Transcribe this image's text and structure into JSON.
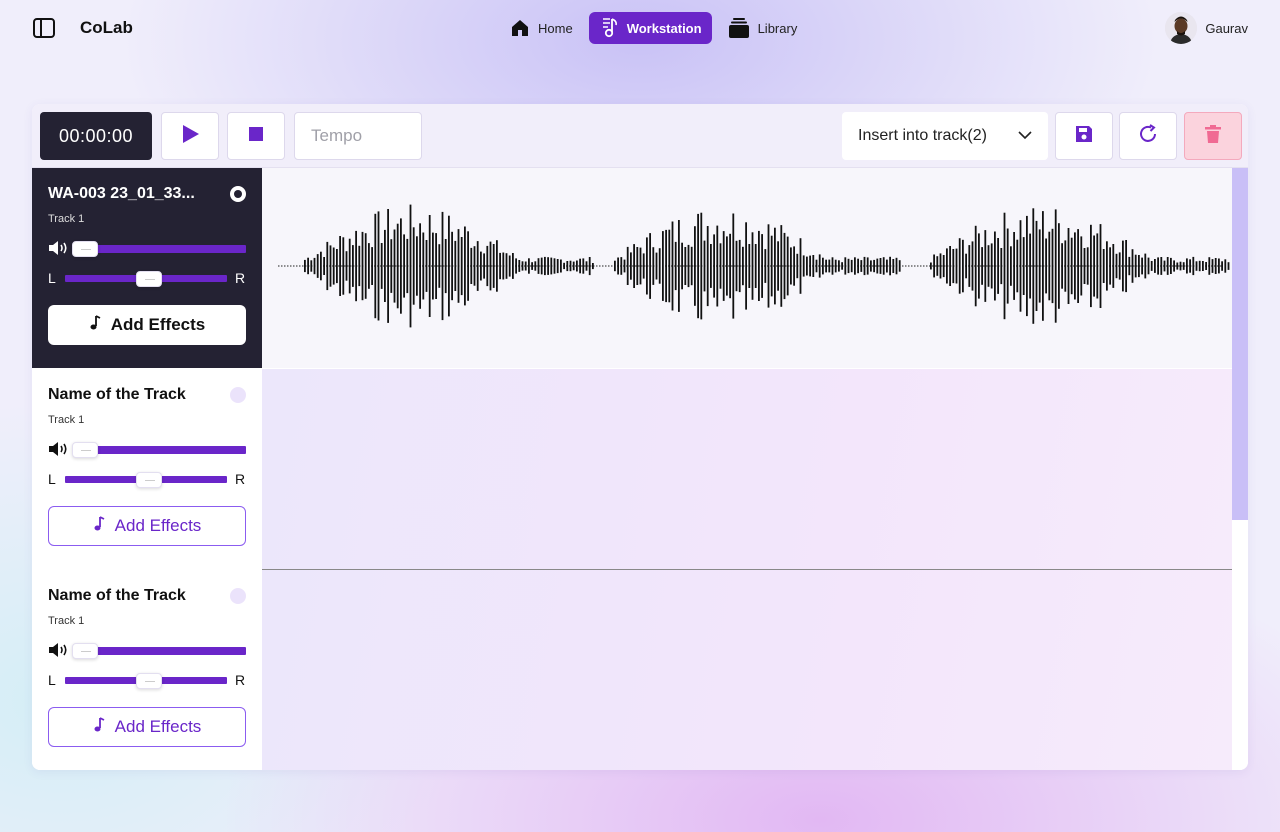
{
  "app": {
    "name": "CoLab"
  },
  "nav": {
    "items": [
      {
        "label": "Home",
        "icon": "home-icon",
        "active": false
      },
      {
        "label": "Workstation",
        "icon": "music-note-icon",
        "active": true
      },
      {
        "label": "Library",
        "icon": "library-icon",
        "active": false
      }
    ]
  },
  "user": {
    "name": "Gaurav"
  },
  "toolbar": {
    "time": "00:00:00",
    "tempo_placeholder": "Tempo",
    "insert_select": "Insert into track(2)"
  },
  "tracks": [
    {
      "name": "WA-003 23_01_33...",
      "subtitle": "Track 1",
      "effects_label": "Add Effects",
      "selected": true,
      "has_audio": true,
      "volume": 0.0,
      "pan": 0.5
    },
    {
      "name": "Name of the Track",
      "subtitle": "Track 1",
      "effects_label": "Add Effects",
      "selected": false,
      "has_audio": false,
      "volume": 0.0,
      "pan": 0.5
    },
    {
      "name": "Name of the Track",
      "subtitle": "Track 1",
      "effects_label": "Add Effects",
      "selected": false,
      "has_audio": false,
      "volume": 0.0,
      "pan": 0.5
    }
  ],
  "pan_labels": {
    "left": "L",
    "right": "R"
  },
  "colors": {
    "accent": "#6a26c9",
    "dark_panel": "#242233",
    "delete_bg": "#fbd3dd",
    "delete_icon": "#f06a93"
  }
}
